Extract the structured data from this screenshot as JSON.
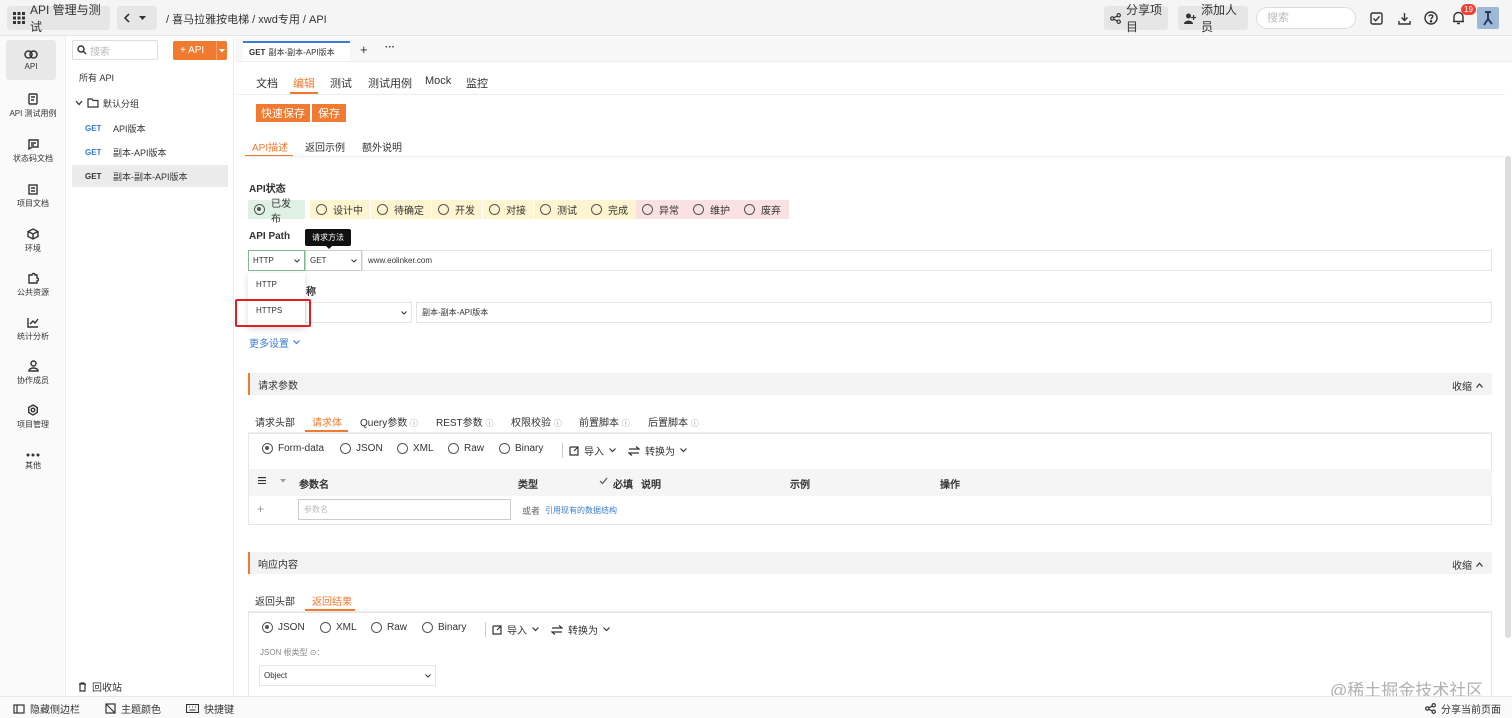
{
  "app_title": "API 管理与测试",
  "breadcrumb": [
    "/",
    "喜马拉雅按电梯",
    "/",
    "xwd专用",
    "/",
    "API"
  ],
  "breadcrumb_text": "/ 喜马拉雅按电梯 / xwd专用 / API",
  "top_actions": {
    "share": "分享项目",
    "add_member": "添加人员",
    "search_placeholder": "搜索",
    "notification_count": "19"
  },
  "rail": [
    "API",
    "API 测试用例",
    "状态码文档",
    "项目文档",
    "环境",
    "公共资源",
    "统计分析",
    "协作成员",
    "项目管理",
    "其他"
  ],
  "tree": {
    "search_placeholder": "搜索",
    "add_button": "+ API",
    "all_api": "所有 API",
    "group": "默认分组",
    "items": [
      {
        "method": "GET",
        "name": "API版本"
      },
      {
        "method": "GET",
        "name": "副本-API版本"
      },
      {
        "method": "GET",
        "name": "副本-副本-API版本"
      }
    ],
    "recycle": "回收站"
  },
  "doc_tab": {
    "method": "GET",
    "name": "副本-副本-API版本",
    "plus": "+",
    "more": "···"
  },
  "mode_tabs": [
    "文档",
    "编辑",
    "测试",
    "测试用例",
    "Mock",
    "监控"
  ],
  "buttons": {
    "quick_save": "快速保存",
    "save": "保存"
  },
  "desc_tabs": [
    "API描述",
    "返回示例",
    "额外说明"
  ],
  "api_status": {
    "label": "API状态",
    "options": [
      "已发布",
      "设计中",
      "待确定",
      "开发",
      "对接",
      "测试",
      "完成",
      "异常",
      "维护",
      "废弃"
    ],
    "selected": "已发布",
    "colors": {
      "green": "#dff0e4",
      "yellow": "#fdf5cf",
      "pink": "#fbe1e1"
    }
  },
  "api_path": {
    "label": "API Path",
    "tooltip": "请求方法",
    "protocol": "HTTP",
    "method": "GET",
    "url": "www.eolinker.com",
    "dropdown": [
      "HTTP",
      "HTTPS"
    ]
  },
  "api_name": {
    "label_partial": "称",
    "value": "副本-副本-API版本"
  },
  "more_settings": "更多设置",
  "request_params": {
    "title": "请求参数",
    "collapse": "收缩",
    "tabs": [
      "请求头部",
      "请求体",
      "Query参数",
      "REST参数",
      "权限校验",
      "前置脚本",
      "后置脚本"
    ],
    "body_types": [
      "Form-data",
      "JSON",
      "XML",
      "Raw",
      "Binary"
    ],
    "import": "导入",
    "convert": "转换为",
    "columns": [
      "参数名",
      "类型",
      "必填",
      "说明",
      "示例",
      "操作"
    ],
    "param_placeholder": "参数名",
    "or": "或者",
    "reference_link": "引用现有的数据结构"
  },
  "response": {
    "title": "响应内容",
    "collapse": "收缩",
    "tabs": [
      "返回头部",
      "返回结果"
    ],
    "types": [
      "JSON",
      "XML",
      "Raw",
      "Binary"
    ],
    "import": "导入",
    "convert": "转换为",
    "root_type_label": "JSON 根类型 ⊙：",
    "root_type_value": "Object"
  },
  "bottom": {
    "hide_sidebar": "隐藏侧边栏",
    "theme": "主题颜色",
    "shortcut": "快捷键",
    "share_page": "分享当前页面"
  },
  "watermark": "@稀土掘金技术社区",
  "accent_color": "#ef7a30",
  "link_color": "#3a7bd5"
}
